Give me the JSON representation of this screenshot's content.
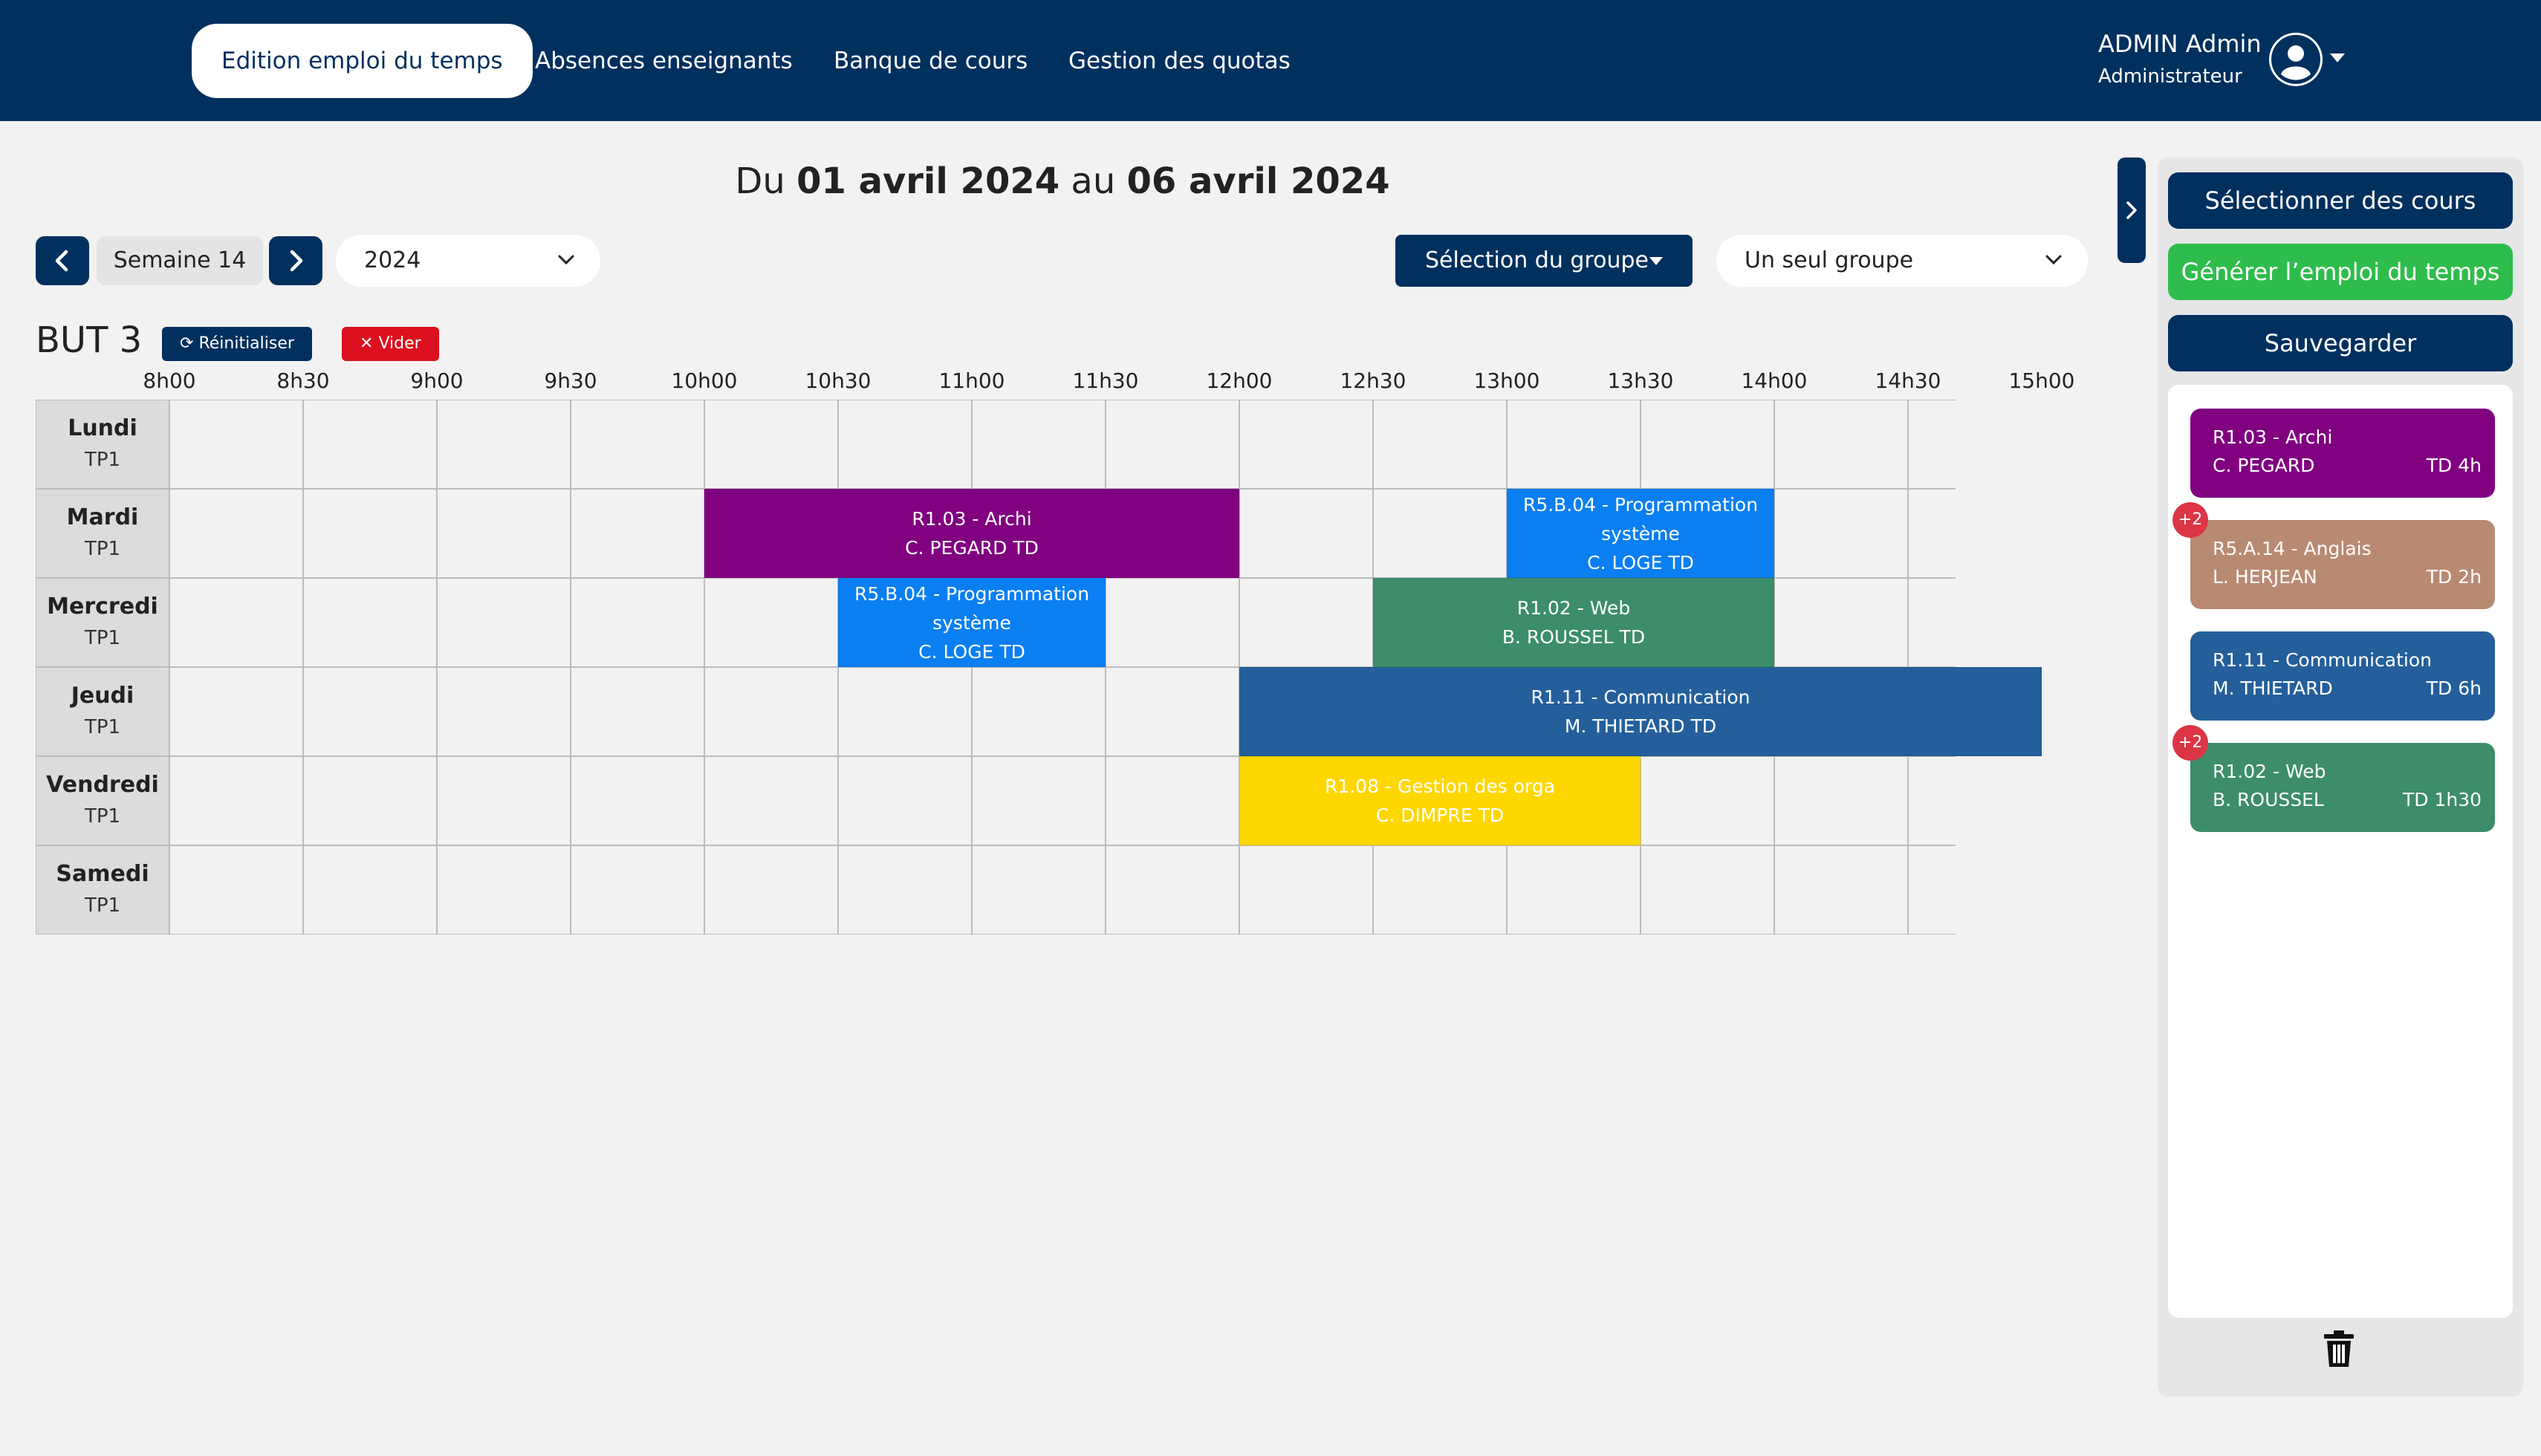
{
  "nav": {
    "items": [
      {
        "label": "Edition emploi du temps",
        "active": true
      },
      {
        "label": "Absences enseignants",
        "active": false
      },
      {
        "label": "Banque de cours",
        "active": false
      },
      {
        "label": "Gestion des quotas",
        "active": false
      }
    ]
  },
  "user": {
    "name": "ADMIN Admin",
    "role": "Administrateur",
    "icon": "user-circle-icon"
  },
  "week": {
    "title_prefix": "Du",
    "start_date": "01 avril 2024",
    "connector": "au",
    "end_date": "06 avril 2024",
    "week_label": "Semaine 14",
    "year": "2024"
  },
  "filters": {
    "group_selection_label": "Sélection du groupe",
    "group_mode": "Un seul groupe"
  },
  "timetable": {
    "group_name": "BUT 3",
    "reset_label": "Réinitialiser",
    "clear_label": "Vider",
    "times": [
      "8h00",
      "8h30",
      "9h00",
      "9h30",
      "10h00",
      "10h30",
      "11h00",
      "11h30",
      "12h00",
      "12h30",
      "13h00",
      "13h30",
      "14h00",
      "14h30",
      "15h00"
    ],
    "days": [
      {
        "name": "Lundi",
        "group": "TP1"
      },
      {
        "name": "Mardi",
        "group": "TP1"
      },
      {
        "name": "Mercredi",
        "group": "TP1"
      },
      {
        "name": "Jeudi",
        "group": "TP1"
      },
      {
        "name": "Vendredi",
        "group": "TP1"
      },
      {
        "name": "Samedi",
        "group": "TP1"
      }
    ],
    "events": [
      {
        "day": 1,
        "start": "10h00",
        "end": "12h00",
        "lines": [
          "R1.03 - Archi",
          "C. PEGARD  TD"
        ],
        "color": "#800080"
      },
      {
        "day": 1,
        "start": "13h00",
        "end": "14h00",
        "lines": [
          "R5.B.04 - Programmation",
          "système",
          "C. LOGE  TD"
        ],
        "color": "#0a7ff2"
      },
      {
        "day": 2,
        "start": "10h30",
        "end": "11h30",
        "lines": [
          "R5.B.04 - Programmation",
          "système",
          "C. LOGE  TD"
        ],
        "color": "#0a7ff2"
      },
      {
        "day": 2,
        "start": "12h30",
        "end": "14h00",
        "lines": [
          "R1.02 - Web",
          "B. ROUSSEL  TD"
        ],
        "color": "#3d8d6a"
      },
      {
        "day": 3,
        "start": "12h00",
        "end": "15h00",
        "lines": [
          "R1.11 - Communication",
          "M. THIETARD  TD"
        ],
        "color": "#245f9b"
      },
      {
        "day": 4,
        "start": "12h00",
        "end": "13h30",
        "lines": [
          "R1.08 - Gestion des orga",
          "C. DIMPRE  TD"
        ],
        "color": "#ffd700"
      }
    ]
  },
  "sidebar": {
    "select_courses_label": "Sélectionner des cours",
    "generate_label": "Générer l’emploi du temps",
    "save_label": "Sauvegarder",
    "cards": [
      {
        "title": "R1.03 - Archi",
        "teacher": "C. PEGARD",
        "hours": "TD 4h",
        "color": "#800080",
        "badge": ""
      },
      {
        "title": "R5.A.14 - Anglais",
        "teacher": "L. HERJEAN",
        "hours": "TD 2h",
        "color": "#b98a72",
        "badge": "+2"
      },
      {
        "title": "R1.11 - Communication",
        "teacher": "M. THIETARD",
        "hours": "TD 6h",
        "color": "#245f9b",
        "badge": ""
      },
      {
        "title": "R1.02 - Web",
        "teacher": "B. ROUSSEL",
        "hours": "TD 1h30",
        "color": "#3d8d6a",
        "badge": "+2"
      }
    ],
    "trash_icon": "trash-icon"
  },
  "colors": {
    "primary": "#00305e",
    "success": "#2ebd4c",
    "danger": "#dc101e"
  }
}
